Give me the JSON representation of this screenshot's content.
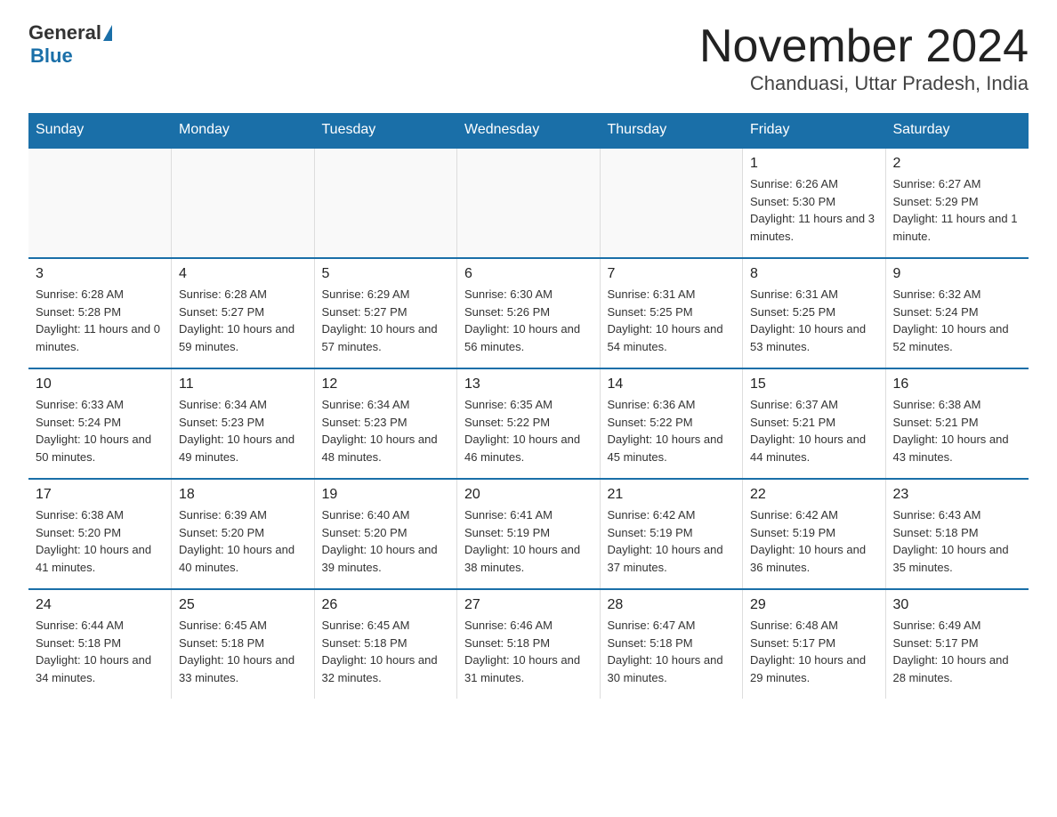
{
  "logo": {
    "part1": "General",
    "part2": "Blue"
  },
  "title": "November 2024",
  "subtitle": "Chanduasi, Uttar Pradesh, India",
  "weekdays": [
    "Sunday",
    "Monday",
    "Tuesday",
    "Wednesday",
    "Thursday",
    "Friday",
    "Saturday"
  ],
  "weeks": [
    [
      {
        "day": "",
        "info": ""
      },
      {
        "day": "",
        "info": ""
      },
      {
        "day": "",
        "info": ""
      },
      {
        "day": "",
        "info": ""
      },
      {
        "day": "",
        "info": ""
      },
      {
        "day": "1",
        "info": "Sunrise: 6:26 AM\nSunset: 5:30 PM\nDaylight: 11 hours and 3 minutes."
      },
      {
        "day": "2",
        "info": "Sunrise: 6:27 AM\nSunset: 5:29 PM\nDaylight: 11 hours and 1 minute."
      }
    ],
    [
      {
        "day": "3",
        "info": "Sunrise: 6:28 AM\nSunset: 5:28 PM\nDaylight: 11 hours and 0 minutes."
      },
      {
        "day": "4",
        "info": "Sunrise: 6:28 AM\nSunset: 5:27 PM\nDaylight: 10 hours and 59 minutes."
      },
      {
        "day": "5",
        "info": "Sunrise: 6:29 AM\nSunset: 5:27 PM\nDaylight: 10 hours and 57 minutes."
      },
      {
        "day": "6",
        "info": "Sunrise: 6:30 AM\nSunset: 5:26 PM\nDaylight: 10 hours and 56 minutes."
      },
      {
        "day": "7",
        "info": "Sunrise: 6:31 AM\nSunset: 5:25 PM\nDaylight: 10 hours and 54 minutes."
      },
      {
        "day": "8",
        "info": "Sunrise: 6:31 AM\nSunset: 5:25 PM\nDaylight: 10 hours and 53 minutes."
      },
      {
        "day": "9",
        "info": "Sunrise: 6:32 AM\nSunset: 5:24 PM\nDaylight: 10 hours and 52 minutes."
      }
    ],
    [
      {
        "day": "10",
        "info": "Sunrise: 6:33 AM\nSunset: 5:24 PM\nDaylight: 10 hours and 50 minutes."
      },
      {
        "day": "11",
        "info": "Sunrise: 6:34 AM\nSunset: 5:23 PM\nDaylight: 10 hours and 49 minutes."
      },
      {
        "day": "12",
        "info": "Sunrise: 6:34 AM\nSunset: 5:23 PM\nDaylight: 10 hours and 48 minutes."
      },
      {
        "day": "13",
        "info": "Sunrise: 6:35 AM\nSunset: 5:22 PM\nDaylight: 10 hours and 46 minutes."
      },
      {
        "day": "14",
        "info": "Sunrise: 6:36 AM\nSunset: 5:22 PM\nDaylight: 10 hours and 45 minutes."
      },
      {
        "day": "15",
        "info": "Sunrise: 6:37 AM\nSunset: 5:21 PM\nDaylight: 10 hours and 44 minutes."
      },
      {
        "day": "16",
        "info": "Sunrise: 6:38 AM\nSunset: 5:21 PM\nDaylight: 10 hours and 43 minutes."
      }
    ],
    [
      {
        "day": "17",
        "info": "Sunrise: 6:38 AM\nSunset: 5:20 PM\nDaylight: 10 hours and 41 minutes."
      },
      {
        "day": "18",
        "info": "Sunrise: 6:39 AM\nSunset: 5:20 PM\nDaylight: 10 hours and 40 minutes."
      },
      {
        "day": "19",
        "info": "Sunrise: 6:40 AM\nSunset: 5:20 PM\nDaylight: 10 hours and 39 minutes."
      },
      {
        "day": "20",
        "info": "Sunrise: 6:41 AM\nSunset: 5:19 PM\nDaylight: 10 hours and 38 minutes."
      },
      {
        "day": "21",
        "info": "Sunrise: 6:42 AM\nSunset: 5:19 PM\nDaylight: 10 hours and 37 minutes."
      },
      {
        "day": "22",
        "info": "Sunrise: 6:42 AM\nSunset: 5:19 PM\nDaylight: 10 hours and 36 minutes."
      },
      {
        "day": "23",
        "info": "Sunrise: 6:43 AM\nSunset: 5:18 PM\nDaylight: 10 hours and 35 minutes."
      }
    ],
    [
      {
        "day": "24",
        "info": "Sunrise: 6:44 AM\nSunset: 5:18 PM\nDaylight: 10 hours and 34 minutes."
      },
      {
        "day": "25",
        "info": "Sunrise: 6:45 AM\nSunset: 5:18 PM\nDaylight: 10 hours and 33 minutes."
      },
      {
        "day": "26",
        "info": "Sunrise: 6:45 AM\nSunset: 5:18 PM\nDaylight: 10 hours and 32 minutes."
      },
      {
        "day": "27",
        "info": "Sunrise: 6:46 AM\nSunset: 5:18 PM\nDaylight: 10 hours and 31 minutes."
      },
      {
        "day": "28",
        "info": "Sunrise: 6:47 AM\nSunset: 5:18 PM\nDaylight: 10 hours and 30 minutes."
      },
      {
        "day": "29",
        "info": "Sunrise: 6:48 AM\nSunset: 5:17 PM\nDaylight: 10 hours and 29 minutes."
      },
      {
        "day": "30",
        "info": "Sunrise: 6:49 AM\nSunset: 5:17 PM\nDaylight: 10 hours and 28 minutes."
      }
    ]
  ]
}
